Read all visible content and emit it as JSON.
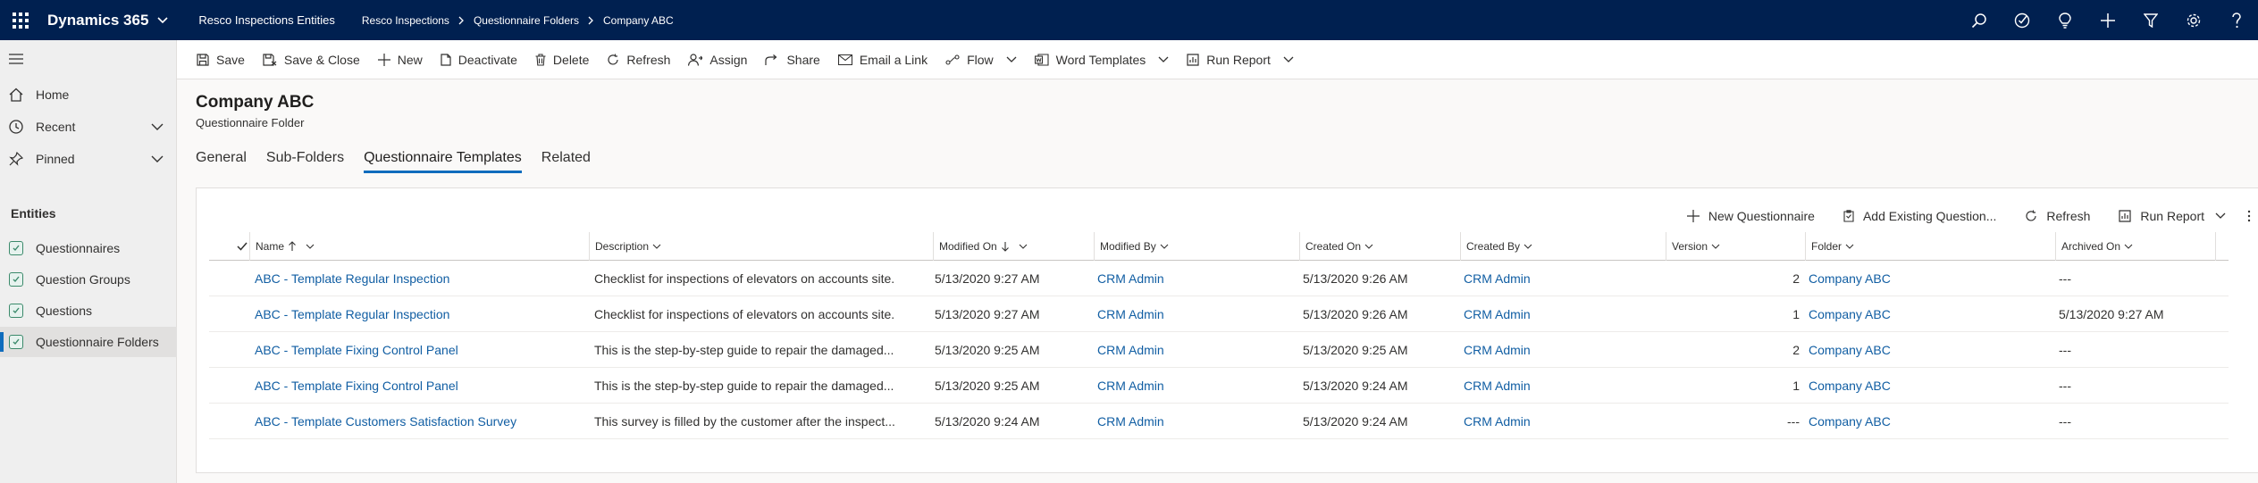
{
  "topbar": {
    "app_name": "Dynamics 365",
    "entity_title": "Resco Inspections Entities",
    "breadcrumbs": [
      "Resco Inspections",
      "Questionnaire Folders",
      "Company ABC"
    ]
  },
  "leftnav": {
    "items": [
      {
        "label": "Home"
      },
      {
        "label": "Recent"
      },
      {
        "label": "Pinned"
      }
    ],
    "section_label": "Entities",
    "entities": [
      {
        "label": "Questionnaires"
      },
      {
        "label": "Question Groups"
      },
      {
        "label": "Questions"
      },
      {
        "label": "Questionnaire Folders"
      }
    ]
  },
  "commands": {
    "save": "Save",
    "save_close": "Save & Close",
    "new": "New",
    "deactivate": "Deactivate",
    "delete": "Delete",
    "refresh": "Refresh",
    "assign": "Assign",
    "share": "Share",
    "email_link": "Email a Link",
    "flow": "Flow",
    "word_templates": "Word Templates",
    "run_report": "Run Report"
  },
  "record": {
    "title": "Company ABC",
    "subtitle": "Questionnaire Folder"
  },
  "tabs": [
    "General",
    "Sub-Folders",
    "Questionnaire Templates",
    "Related"
  ],
  "subgrid_commands": {
    "new_questionnaire": "New Questionnaire",
    "add_existing": "Add Existing Question...",
    "refresh": "Refresh",
    "run_report": "Run Report"
  },
  "grid": {
    "columns": [
      "Name",
      "Description",
      "Modified On",
      "Modified By",
      "Created On",
      "Created By",
      "Version",
      "Folder",
      "Archived On"
    ],
    "rows": [
      [
        "ABC - Template Regular Inspection",
        "Checklist for inspections of elevators on accounts site.",
        "5/13/2020 9:27 AM",
        "CRM Admin",
        "5/13/2020 9:26 AM",
        "CRM Admin",
        "2",
        "Company ABC",
        "---"
      ],
      [
        "ABC - Template Regular Inspection",
        "Checklist for inspections of elevators on accounts site.",
        "5/13/2020 9:27 AM",
        "CRM Admin",
        "5/13/2020 9:26 AM",
        "CRM Admin",
        "1",
        "Company ABC",
        "5/13/2020 9:27 AM"
      ],
      [
        "ABC - Template Fixing Control Panel",
        "This is the step-by-step guide to repair the damaged...",
        "5/13/2020 9:25 AM",
        "CRM Admin",
        "5/13/2020 9:25 AM",
        "CRM Admin",
        "2",
        "Company ABC",
        "---"
      ],
      [
        "ABC - Template Fixing Control Panel",
        "This is the step-by-step guide to repair the damaged...",
        "5/13/2020 9:25 AM",
        "CRM Admin",
        "5/13/2020 9:24 AM",
        "CRM Admin",
        "1",
        "Company ABC",
        "---"
      ],
      [
        "ABC - Template Customers Satisfaction Survey",
        "This survey is filled by the customer after the inspect...",
        "5/13/2020 9:24 AM",
        "CRM Admin",
        "5/13/2020 9:24 AM",
        "CRM Admin",
        "---",
        "Company ABC",
        "---"
      ]
    ]
  },
  "colors": {
    "topbar": "#002050",
    "accent": "#0f6cbd",
    "link": "#115ea3"
  }
}
